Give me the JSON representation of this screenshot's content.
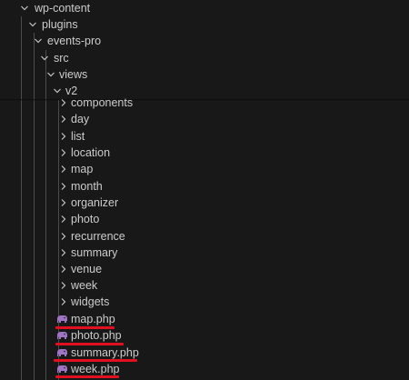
{
  "explorer": {
    "tree": [
      {
        "label": "wp-content",
        "type": "folder",
        "expanded": true
      },
      {
        "label": "plugins",
        "type": "folder",
        "expanded": true
      },
      {
        "label": "events-pro",
        "type": "folder",
        "expanded": true
      },
      {
        "label": "src",
        "type": "folder",
        "expanded": true
      },
      {
        "label": "views",
        "type": "folder",
        "expanded": true
      },
      {
        "label": "v2",
        "type": "folder",
        "expanded": true
      }
    ],
    "v2_folders": [
      {
        "label": "components"
      },
      {
        "label": "day"
      },
      {
        "label": "list"
      },
      {
        "label": "location"
      },
      {
        "label": "map"
      },
      {
        "label": "month"
      },
      {
        "label": "organizer"
      },
      {
        "label": "photo"
      },
      {
        "label": "recurrence"
      },
      {
        "label": "summary"
      },
      {
        "label": "venue"
      },
      {
        "label": "week"
      },
      {
        "label": "widgets"
      }
    ],
    "v2_files": [
      {
        "label": "map.php",
        "icon": "php-elephant-icon",
        "highlighted": true
      },
      {
        "label": "photo.php",
        "icon": "php-elephant-icon",
        "highlighted": true
      },
      {
        "label": "summary.php",
        "icon": "php-elephant-icon",
        "highlighted": true
      },
      {
        "label": "week.php",
        "icon": "php-elephant-icon",
        "highlighted": true
      }
    ]
  },
  "colors": {
    "background": "#181818",
    "text": "#cccccc",
    "php_icon": "#a074c4",
    "highlight_underline": "#e01020"
  }
}
